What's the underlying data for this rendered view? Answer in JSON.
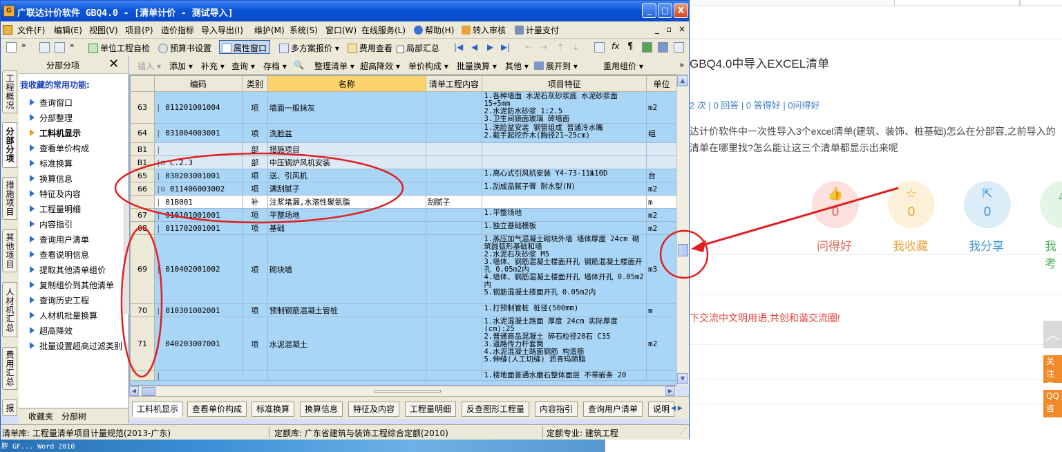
{
  "window": {
    "title": "广联达计价软件 GBQ4.0 - [清单计价 - 测试导入]",
    "controls": {
      "minimize": "_",
      "maximize": "□",
      "close": "X"
    }
  },
  "menu": {
    "items": [
      "文件(F)",
      "编辑(E)",
      "视图(V)",
      "项目(P)",
      "造价指标",
      "导入导出(I)",
      "维护(M)",
      "系统(S)",
      "窗口(W)",
      "在线服务(L)",
      "帮助(H)",
      "转入审核",
      "计量支付"
    ],
    "mdi_controls": [
      "_",
      "ð",
      "×"
    ]
  },
  "toolbar": {
    "self_check": "单位工程自检",
    "budget_setting": "预算书设置",
    "property_window": "属性窗口",
    "multi_scheme": "多方案报价",
    "fee_view": "费用查看",
    "partial_summary": "局部汇总"
  },
  "vtabs": [
    "工程概况",
    "分部分项",
    "措施项目",
    "其他项目",
    "人材机汇总",
    "费用汇总",
    "报"
  ],
  "left_panel": {
    "title": "分部分项",
    "close": "✕",
    "favorites_title": "我收藏的常用功能:",
    "items": [
      {
        "label": "查询窗口",
        "bold": false
      },
      {
        "label": "分部整理",
        "bold": false
      },
      {
        "label": "工料机显示",
        "bold": true
      },
      {
        "label": "查看单价构成",
        "bold": false
      },
      {
        "label": "标准换算",
        "bold": false
      },
      {
        "label": "换算信息",
        "bold": false
      },
      {
        "label": "特征及内容",
        "bold": false
      },
      {
        "label": "工程量明细",
        "bold": false
      },
      {
        "label": "内容指引",
        "bold": false
      },
      {
        "label": "查询用户清单",
        "bold": false
      },
      {
        "label": "查看说明信息",
        "bold": false
      },
      {
        "label": "提取其他清单组价",
        "bold": false
      },
      {
        "label": "复制组价到其他清单",
        "bold": false
      },
      {
        "label": "查询历史工程",
        "bold": false
      },
      {
        "label": "人材机批量换算",
        "bold": false
      },
      {
        "label": "超高降效",
        "bold": false
      },
      {
        "label": "批量设置超高过滤类别",
        "bold": false
      }
    ],
    "bottom_tabs": [
      "收藏夹",
      "分部树"
    ]
  },
  "toolbar2": {
    "insert": "插入",
    "add": "添加",
    "supplement": "补充",
    "query": "查询",
    "save": "存档",
    "organize": "整理清单",
    "super_high": "超高降效",
    "unit_comp": "单价构成",
    "batch": "批量换算",
    "other": "其他",
    "expand": "展开到",
    "reuse": "重用组价",
    "more": "»"
  },
  "grid": {
    "headers": [
      "编码",
      "类别",
      "名称",
      "清单工程内容",
      "项目特征",
      "单位"
    ],
    "rows": [
      {
        "num": "63",
        "code": "011201001004",
        "type": "项",
        "name": "墙面一般抹灰",
        "content": "",
        "feature": "1.各种墙面 水泥石灰砂浆底 水泥砂浆面 15+5mm\n2.水泥防水砂浆 1:2.5\n3.卫生间镜面玻璃 砖墙面",
        "unit": "m2",
        "style": "blue",
        "h": 44
      },
      {
        "num": "64",
        "code": "031004003001",
        "type": "项",
        "name": "洗脸盆",
        "content": "",
        "feature": "1.洗脸盆安装 钢管组成 普通冷水嘴\n2.截手起挖乔木(胸径21~25cm)",
        "unit": "组",
        "style": "blue",
        "h": 28
      },
      {
        "num": "B1",
        "code": "",
        "type": "部",
        "name": "措施项目",
        "content": "",
        "feature": "",
        "unit": "",
        "style": "pale",
        "h": 19
      },
      {
        "num": "B1",
        "code": "C.2.3",
        "type": "部",
        "name": "中压锅炉风机安装",
        "content": "",
        "feature": "",
        "unit": "",
        "style": "pale",
        "h": 19
      },
      {
        "num": "65",
        "code": "030203001001",
        "type": "项",
        "name": "送、引风机",
        "content": "",
        "feature": "1.离心式引风机安装 Y4-73-11№10D",
        "unit": "台",
        "style": "blue",
        "h": 19
      },
      {
        "num": "66",
        "code": "011406003002",
        "type": "项",
        "name": "满刮腻子",
        "content": "",
        "feature": "1.刮成品腻子膏 耐水型(N)",
        "unit": "m2",
        "style": "blue",
        "h": 19
      },
      {
        "num": "",
        "code": "01B001",
        "type": "补",
        "name": "注浆堵漏,水溶性聚氨脂",
        "content": "刮腻子",
        "feature": "",
        "unit": "m",
        "style": "white",
        "h": 19
      },
      {
        "num": "67",
        "code": "010101001001",
        "type": "项",
        "name": "平整场地",
        "content": "",
        "feature": "1.平整场地",
        "unit": "m2",
        "style": "blue",
        "h": 19
      },
      {
        "num": "68",
        "code": "011702001001",
        "type": "项",
        "name": "基础",
        "content": "",
        "feature": "1.独立基础模板",
        "unit": "m2",
        "style": "blue",
        "h": 19
      },
      {
        "num": "69",
        "code": "010402001002",
        "type": "项",
        "name": "砌块墙",
        "content": "",
        "feature": "1.蒸压加气混凝土砌块外墙 墙体厚度 24cm 砌筑圆弧形基础和墙\n2.水泥石灰砂浆 M5\n3.墙体、钢筋混凝土楼面开孔 钢筋混凝土楼面开孔 0.05m2内\n4.墙体、钢筋混凝土楼面开孔 墙体开孔 0.05m2内\n5.钢筋混凝土楼面开孔 0.05m2内",
        "unit": "m3",
        "style": "blue",
        "h": 100
      },
      {
        "num": "70",
        "code": "010301002001",
        "type": "项",
        "name": "预制钢筋混凝土管桩",
        "content": "",
        "feature": "1.打预制管桩 桩径(500mm)",
        "unit": "m",
        "style": "blue",
        "h": 19
      },
      {
        "num": "71",
        "code": "040203007001",
        "type": "项",
        "name": "水泥混凝土",
        "content": "",
        "feature": "1.水泥混凝土路面 厚度 24cm 实际厚度(cm):25\n2.普通商品混凝土 碎石粒径20石 C35\n3.道路传力杆套筒\n4.水泥混凝土路面钢筋 构造筋\n5.伸缝(人工切缝) 沥青玛蹄脂",
        "unit": "m2",
        "style": "blue",
        "h": 78
      },
      {
        "num": "",
        "code": "",
        "type": "",
        "name": "",
        "content": "",
        "feature": "1.楼地面普通水磨石整体面层 不带嵌条 20",
        "unit": "",
        "style": "blue",
        "h": 14
      }
    ]
  },
  "bottom_tabs": [
    "工料机显示",
    "查看单价构成",
    "标准换算",
    "换算信息",
    "特征及内容",
    "工程量明细",
    "反查图形工程量",
    "内容指引",
    "查询用户清单",
    "说明"
  ],
  "status": {
    "lib": "清单库: 工程量清单项目计量规范(2013-广东)",
    "quota": "定额库: 广东省建筑与装饰工程综合定额(2010)",
    "major": "定额专业: 建筑工程"
  },
  "taskbar_text": "胖 GF... Word 2010",
  "web": {
    "question_title": "GBQ4.0中导入EXCEL清单",
    "stats": "2 次 | 0 回答 | 0 答得好 | 0问得好",
    "description": "达计价软件中一次性导入3个excel清单(建筑、装饰、桩基础)怎么在分部容,之前导入的清单在哪里找?怎么能让这三个清单都显示出来呢",
    "actions": [
      {
        "label": "问得好",
        "count": "0",
        "color": "#e0675d",
        "bg": "#fbe0de",
        "icon": "thumb-icon"
      },
      {
        "label": "我收藏",
        "count": "0",
        "color": "#e8a23a",
        "bg": "#fdf0d8",
        "icon": "star-icon"
      },
      {
        "label": "我分享",
        "count": "0",
        "color": "#3e97d6",
        "bg": "#dcedfa",
        "icon": "share-icon"
      },
      {
        "label": "我考",
        "count": "",
        "color": "#4caf63",
        "bg": "#e3f5e6",
        "icon": "check-icon"
      }
    ],
    "note": "下交流中文明用语,共创和谐交流圈!",
    "side_follow": "关注我们",
    "side_qq": "QQ咨询"
  }
}
